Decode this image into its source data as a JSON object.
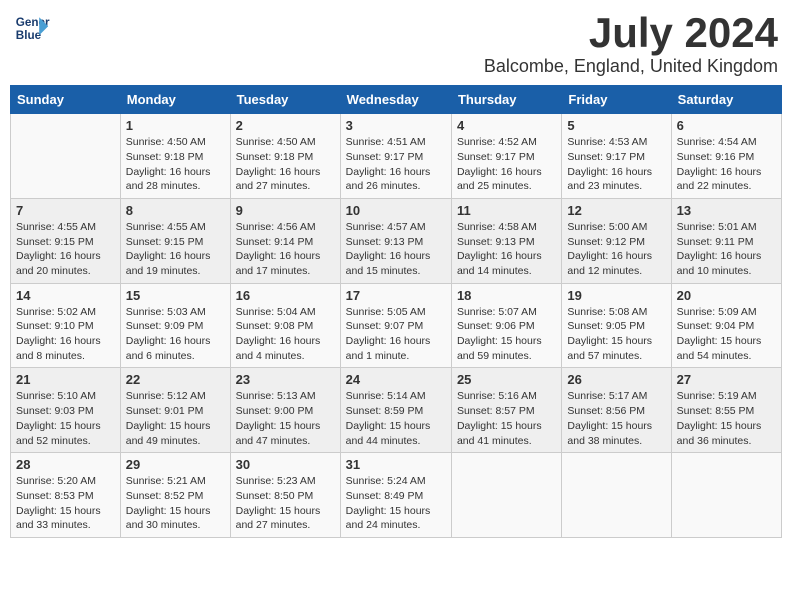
{
  "logo": {
    "line1": "General",
    "line2": "Blue"
  },
  "title": "July 2024",
  "location": "Balcombe, England, United Kingdom",
  "weekdays": [
    "Sunday",
    "Monday",
    "Tuesday",
    "Wednesday",
    "Thursday",
    "Friday",
    "Saturday"
  ],
  "weeks": [
    [
      {
        "day": "",
        "info": ""
      },
      {
        "day": "1",
        "info": "Sunrise: 4:50 AM\nSunset: 9:18 PM\nDaylight: 16 hours\nand 28 minutes."
      },
      {
        "day": "2",
        "info": "Sunrise: 4:50 AM\nSunset: 9:18 PM\nDaylight: 16 hours\nand 27 minutes."
      },
      {
        "day": "3",
        "info": "Sunrise: 4:51 AM\nSunset: 9:17 PM\nDaylight: 16 hours\nand 26 minutes."
      },
      {
        "day": "4",
        "info": "Sunrise: 4:52 AM\nSunset: 9:17 PM\nDaylight: 16 hours\nand 25 minutes."
      },
      {
        "day": "5",
        "info": "Sunrise: 4:53 AM\nSunset: 9:17 PM\nDaylight: 16 hours\nand 23 minutes."
      },
      {
        "day": "6",
        "info": "Sunrise: 4:54 AM\nSunset: 9:16 PM\nDaylight: 16 hours\nand 22 minutes."
      }
    ],
    [
      {
        "day": "7",
        "info": "Sunrise: 4:55 AM\nSunset: 9:15 PM\nDaylight: 16 hours\nand 20 minutes."
      },
      {
        "day": "8",
        "info": "Sunrise: 4:55 AM\nSunset: 9:15 PM\nDaylight: 16 hours\nand 19 minutes."
      },
      {
        "day": "9",
        "info": "Sunrise: 4:56 AM\nSunset: 9:14 PM\nDaylight: 16 hours\nand 17 minutes."
      },
      {
        "day": "10",
        "info": "Sunrise: 4:57 AM\nSunset: 9:13 PM\nDaylight: 16 hours\nand 15 minutes."
      },
      {
        "day": "11",
        "info": "Sunrise: 4:58 AM\nSunset: 9:13 PM\nDaylight: 16 hours\nand 14 minutes."
      },
      {
        "day": "12",
        "info": "Sunrise: 5:00 AM\nSunset: 9:12 PM\nDaylight: 16 hours\nand 12 minutes."
      },
      {
        "day": "13",
        "info": "Sunrise: 5:01 AM\nSunset: 9:11 PM\nDaylight: 16 hours\nand 10 minutes."
      }
    ],
    [
      {
        "day": "14",
        "info": "Sunrise: 5:02 AM\nSunset: 9:10 PM\nDaylight: 16 hours\nand 8 minutes."
      },
      {
        "day": "15",
        "info": "Sunrise: 5:03 AM\nSunset: 9:09 PM\nDaylight: 16 hours\nand 6 minutes."
      },
      {
        "day": "16",
        "info": "Sunrise: 5:04 AM\nSunset: 9:08 PM\nDaylight: 16 hours\nand 4 minutes."
      },
      {
        "day": "17",
        "info": "Sunrise: 5:05 AM\nSunset: 9:07 PM\nDaylight: 16 hours\nand 1 minute."
      },
      {
        "day": "18",
        "info": "Sunrise: 5:07 AM\nSunset: 9:06 PM\nDaylight: 15 hours\nand 59 minutes."
      },
      {
        "day": "19",
        "info": "Sunrise: 5:08 AM\nSunset: 9:05 PM\nDaylight: 15 hours\nand 57 minutes."
      },
      {
        "day": "20",
        "info": "Sunrise: 5:09 AM\nSunset: 9:04 PM\nDaylight: 15 hours\nand 54 minutes."
      }
    ],
    [
      {
        "day": "21",
        "info": "Sunrise: 5:10 AM\nSunset: 9:03 PM\nDaylight: 15 hours\nand 52 minutes."
      },
      {
        "day": "22",
        "info": "Sunrise: 5:12 AM\nSunset: 9:01 PM\nDaylight: 15 hours\nand 49 minutes."
      },
      {
        "day": "23",
        "info": "Sunrise: 5:13 AM\nSunset: 9:00 PM\nDaylight: 15 hours\nand 47 minutes."
      },
      {
        "day": "24",
        "info": "Sunrise: 5:14 AM\nSunset: 8:59 PM\nDaylight: 15 hours\nand 44 minutes."
      },
      {
        "day": "25",
        "info": "Sunrise: 5:16 AM\nSunset: 8:57 PM\nDaylight: 15 hours\nand 41 minutes."
      },
      {
        "day": "26",
        "info": "Sunrise: 5:17 AM\nSunset: 8:56 PM\nDaylight: 15 hours\nand 38 minutes."
      },
      {
        "day": "27",
        "info": "Sunrise: 5:19 AM\nSunset: 8:55 PM\nDaylight: 15 hours\nand 36 minutes."
      }
    ],
    [
      {
        "day": "28",
        "info": "Sunrise: 5:20 AM\nSunset: 8:53 PM\nDaylight: 15 hours\nand 33 minutes."
      },
      {
        "day": "29",
        "info": "Sunrise: 5:21 AM\nSunset: 8:52 PM\nDaylight: 15 hours\nand 30 minutes."
      },
      {
        "day": "30",
        "info": "Sunrise: 5:23 AM\nSunset: 8:50 PM\nDaylight: 15 hours\nand 27 minutes."
      },
      {
        "day": "31",
        "info": "Sunrise: 5:24 AM\nSunset: 8:49 PM\nDaylight: 15 hours\nand 24 minutes."
      },
      {
        "day": "",
        "info": ""
      },
      {
        "day": "",
        "info": ""
      },
      {
        "day": "",
        "info": ""
      }
    ]
  ]
}
